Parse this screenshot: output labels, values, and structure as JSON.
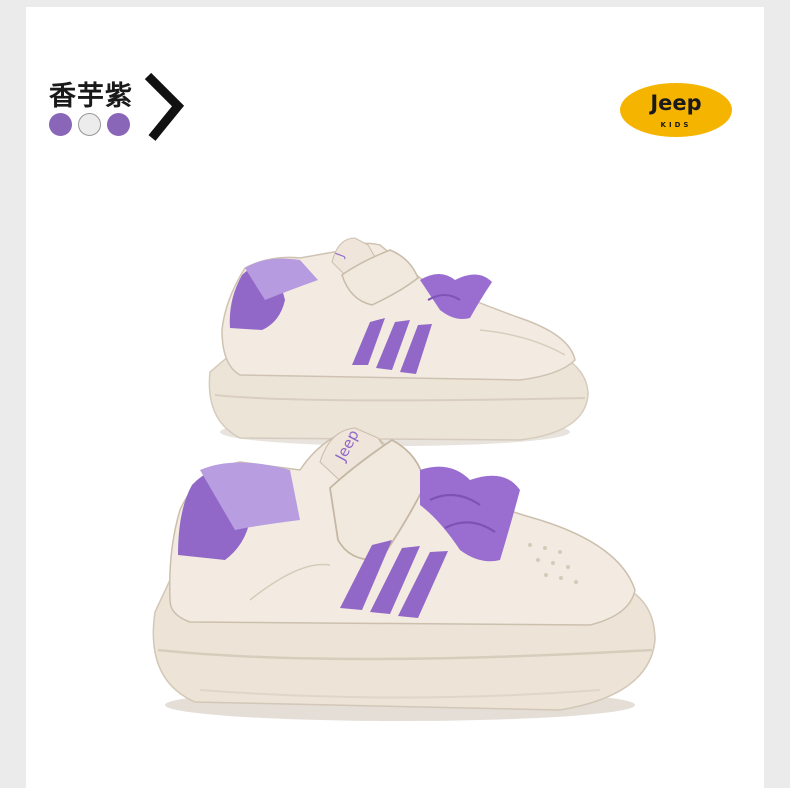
{
  "color_label": "香芋紫",
  "swatch_colors": [
    "#8a66b9",
    "#ececec",
    "#8a66b9"
  ],
  "brand": {
    "logo_text": "Jeep",
    "logo_subtext": "KIDS",
    "logo_color": "#f4b400"
  },
  "shoe_tongue_text": "Jeep",
  "colors": {
    "upper": "#f1e8de",
    "accent": "#9168c8",
    "sole": "#ece2d6"
  }
}
